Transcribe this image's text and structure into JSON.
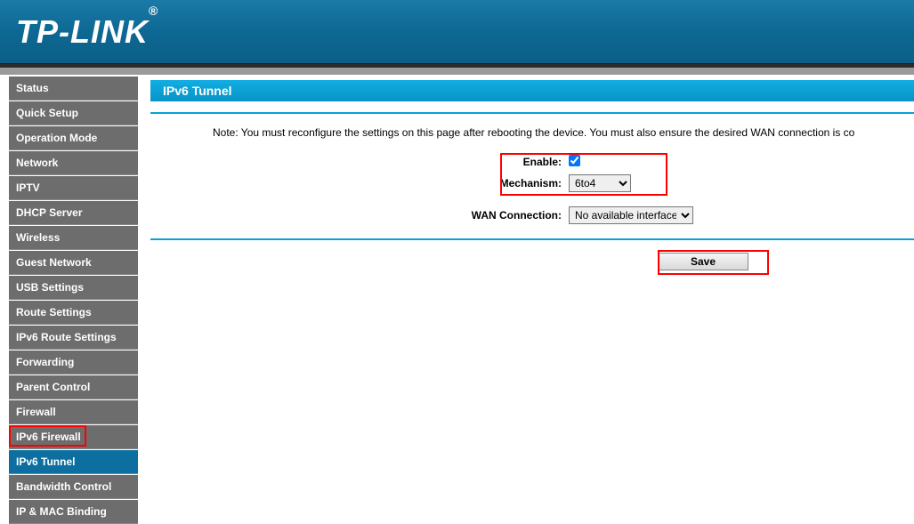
{
  "brand": {
    "name": "TP-LINK",
    "reg": "®"
  },
  "sidebar": {
    "items": [
      {
        "label": "Status"
      },
      {
        "label": "Quick Setup"
      },
      {
        "label": "Operation Mode"
      },
      {
        "label": "Network"
      },
      {
        "label": "IPTV"
      },
      {
        "label": "DHCP Server"
      },
      {
        "label": "Wireless"
      },
      {
        "label": "Guest Network"
      },
      {
        "label": "USB Settings"
      },
      {
        "label": "Route Settings"
      },
      {
        "label": "IPv6 Route Settings"
      },
      {
        "label": "Forwarding"
      },
      {
        "label": "Parent Control"
      },
      {
        "label": "Firewall"
      },
      {
        "label": "IPv6 Firewall"
      },
      {
        "label": "IPv6 Tunnel"
      },
      {
        "label": "Bandwidth Control"
      },
      {
        "label": "IP & MAC Binding"
      }
    ],
    "active_index": 15
  },
  "page": {
    "title": "IPv6 Tunnel",
    "note": "Note: You must reconfigure the settings on this page after rebooting the device. You must also ensure the desired WAN connection is co",
    "form": {
      "enable_label": "Enable:",
      "enable_checked": true,
      "mechanism_label": "Mechanism:",
      "mechanism_value": "6to4",
      "wan_label": "WAN Connection:",
      "wan_value": "No available interface."
    },
    "save_label": "Save"
  }
}
